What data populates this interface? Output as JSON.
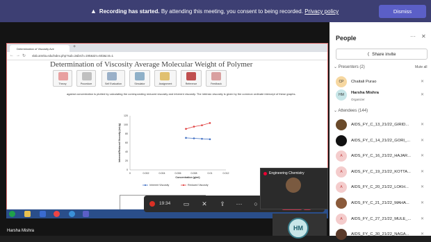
{
  "banner": {
    "bold": "Recording has started.",
    "text": " By attending this meeting, you consent to being recorded. ",
    "link": "Privacy policy",
    "dismiss": "Dismiss"
  },
  "browser": {
    "tab_title": "Determination of Viscosity Ave",
    "url": "vlab.amrita.edu/index.php?sub=2&brch=190&sim=603&cnt=1",
    "page_title": "Determination of Viscosity Average Molecular Weight of Polymer",
    "menu": [
      "Theory",
      "Procedure",
      "Self Evaluation",
      "Simulator",
      "Assignment",
      "Reference",
      "Feedback"
    ],
    "paragraph": "against concentration is plotted by calculating the corresponding reduced viscosity and inherent viscosity. The intrinsic viscosity is given by the common ordinate intercept of these graphs."
  },
  "chart_data": {
    "type": "line",
    "xlabel": "Concentration (g/ml)",
    "ylabel": "Inherent/Reduced Viscosity (mL/g)",
    "ylim": [
      0,
      120
    ],
    "xlim": [
      0,
      0.012
    ],
    "xticks": [
      "0",
      "0.002",
      "0.004",
      "0.006",
      "0.008",
      "0.01",
      "0.012"
    ],
    "yticks": [
      "0",
      "20",
      "40",
      "60",
      "80",
      "100",
      "120"
    ],
    "series": [
      {
        "name": "Inherent Viscosity",
        "color": "#4472c4",
        "x": [
          0.007,
          0.008,
          0.009,
          0.01
        ],
        "y": [
          71,
          70,
          69,
          68
        ]
      },
      {
        "name": "Reduced Viscosity",
        "color": "#e04040",
        "x": [
          0.007,
          0.008,
          0.009,
          0.01
        ],
        "y": [
          91,
          96,
          99,
          104
        ]
      }
    ],
    "legend": "bottom"
  },
  "toolbar": {
    "timer": "19:34"
  },
  "video": {
    "tile_label": "Engineering Chemistry",
    "self_name": "Harsha Mishra",
    "self_initials": "HM"
  },
  "people": {
    "title": "People",
    "share_invite": "Share invite",
    "presenters_label": "Presenters (2)",
    "mute_all": "Mute all",
    "presenters": [
      {
        "initials": "CP",
        "name": "Chaitali Purao",
        "role": "",
        "color": "#f6d7a0"
      },
      {
        "initials": "HM",
        "name": "Harsha Mishra",
        "role": "Organizer",
        "color": "#c8e6e8"
      }
    ],
    "attendees_label": "Attendees (144)",
    "attendees": [
      {
        "initials": "",
        "name": "AIDS_FY_C_13_21/22_GIRID...",
        "color": "#6a4a2a"
      },
      {
        "initials": "",
        "name": "AIDS_FY_C_14_21/22_GORI_...",
        "color": "#111111"
      },
      {
        "initials": "A",
        "name": "AIDS_FY_C_16_21/22_HAJAR...",
        "color": "#f4cccc"
      },
      {
        "initials": "A",
        "name": "AIDS_FY_C_19_21/22_KOTTA...",
        "color": "#f4cccc"
      },
      {
        "initials": "A",
        "name": "AIDS_FY_C_20_21/22_LOKH...",
        "color": "#f4cccc"
      },
      {
        "initials": "",
        "name": "AIDS_FY_C_21_21/22_MAHA...",
        "color": "#8a5a3a"
      },
      {
        "initials": "A",
        "name": "AIDS_FY_C_27_21/22_MULE_...",
        "color": "#f4cccc"
      },
      {
        "initials": "",
        "name": "AIDS_FY_C_30_21/22_NAGA...",
        "color": "#5a3a2a"
      }
    ]
  }
}
